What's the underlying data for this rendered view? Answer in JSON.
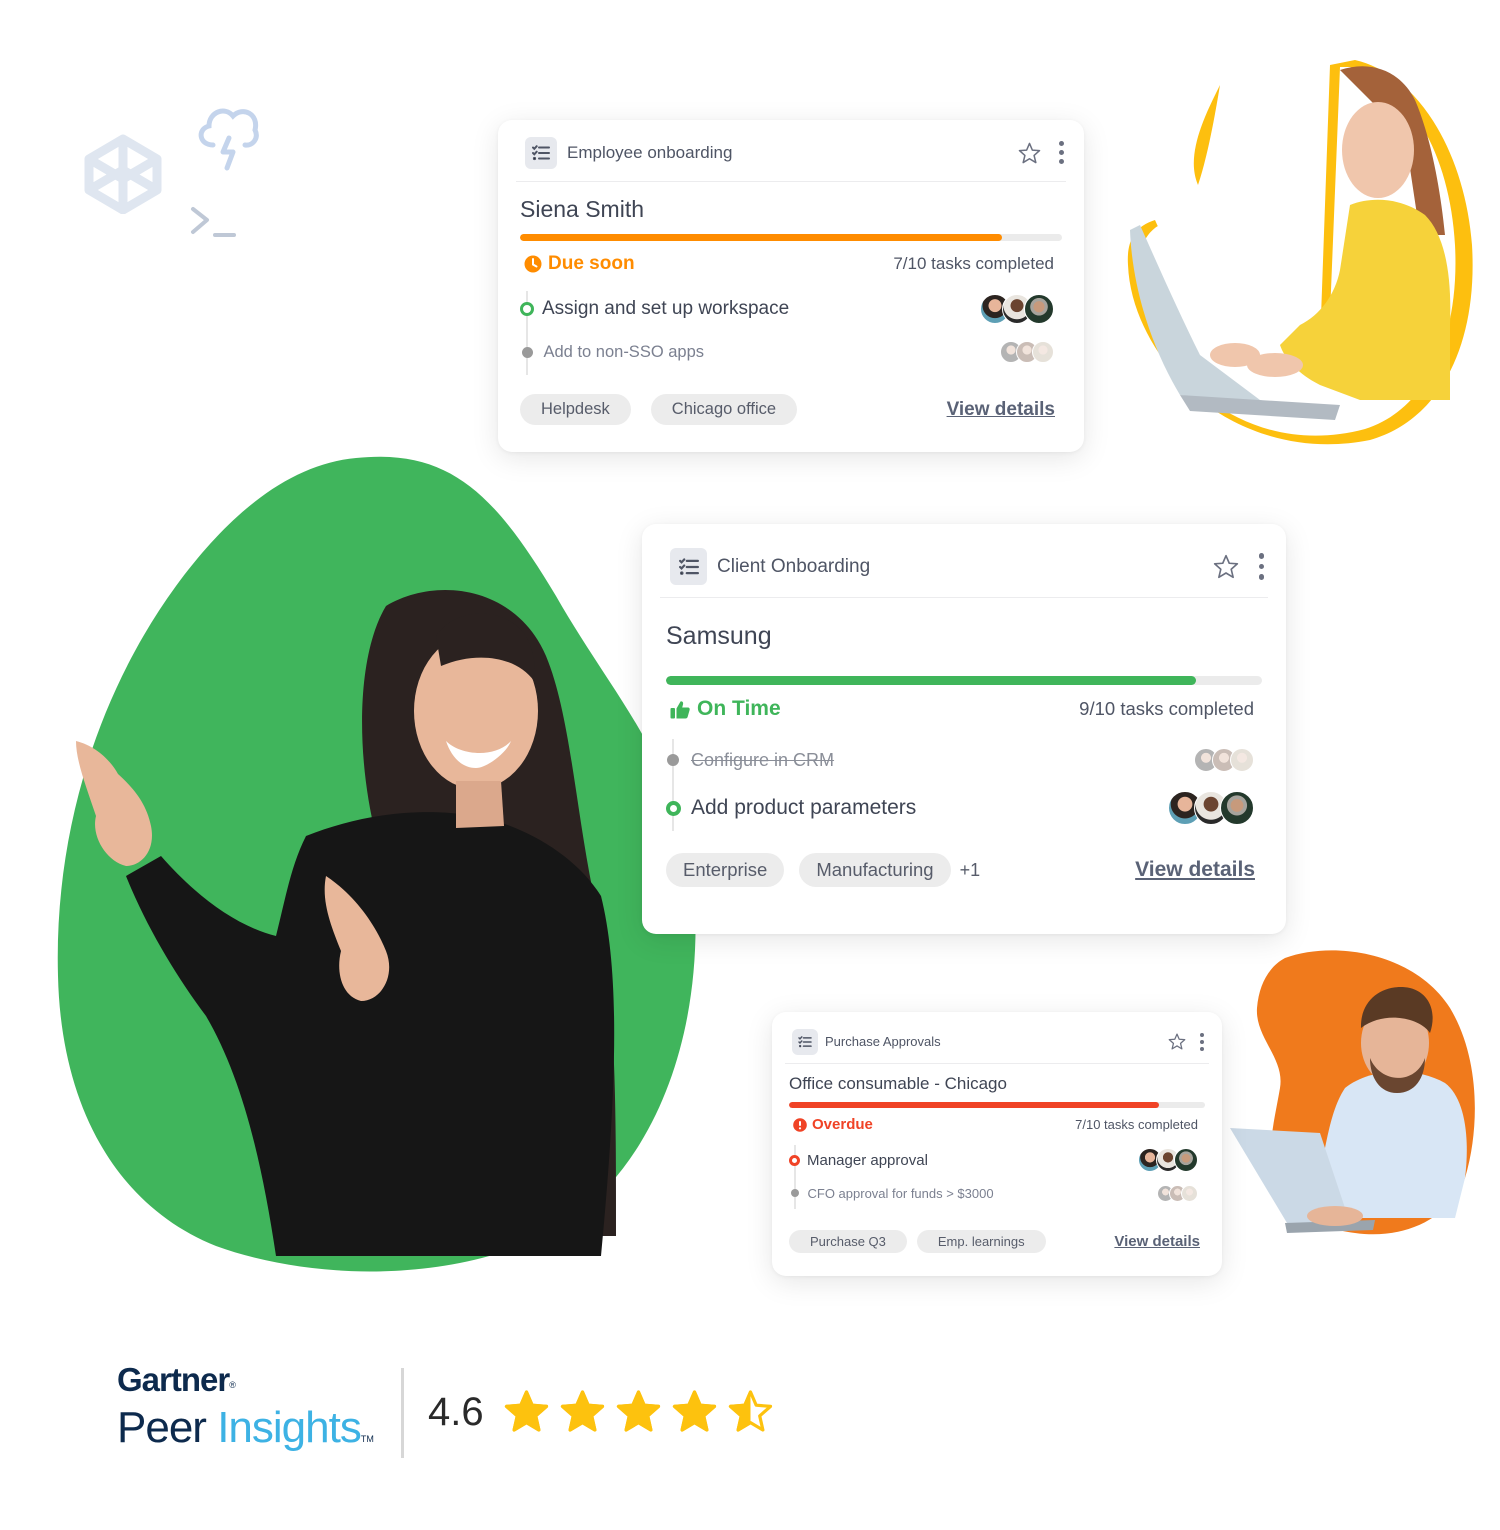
{
  "decorations": {
    "icons": [
      "codepen-cube-icon",
      "cloud-lightning-icon",
      "terminal-prompt-icon"
    ]
  },
  "colors": {
    "orange_status": "#ff8c00",
    "green_status": "#3fb55a",
    "red_status": "#f04326",
    "green_blob": "#40b55c",
    "yellow_blob": "#fdbf0f",
    "orange_blob": "#f07a1c",
    "star": "#fdc20e",
    "gartner_navy": "#0d2a4d",
    "gartner_blue": "#3db2e4"
  },
  "cards": [
    {
      "category": "Employee onboarding",
      "title": "Siena Smith",
      "progress": 0.89,
      "progress_color": "#ff8c00",
      "status": {
        "label": "Due soon",
        "icon": "clock-icon",
        "color": "#ff8c00"
      },
      "count": "7/10 tasks completed",
      "tasks": [
        {
          "label": "Assign and set up workspace",
          "state": "active",
          "avatars": 3
        },
        {
          "label": "Add to non-SSO apps",
          "state": "pending",
          "avatars": 3
        }
      ],
      "tags": [
        "Helpdesk",
        "Chicago office"
      ],
      "link": "View details"
    },
    {
      "category": "Client Onboarding",
      "title": "Samsung",
      "progress": 0.89,
      "progress_color": "#3fb55a",
      "status": {
        "label": "On Time",
        "icon": "thumbs-up-icon",
        "color": "#3fb55a"
      },
      "count": "9/10 tasks completed",
      "tasks": [
        {
          "label": "Configure in CRM",
          "state": "done",
          "avatars": 3
        },
        {
          "label": "Add product parameters",
          "state": "active",
          "avatars": 3
        }
      ],
      "tags": [
        "Enterprise",
        "Manufacturing"
      ],
      "extra_tags": "+1",
      "link": "View details"
    },
    {
      "category": "Purchase Approvals",
      "title": "Office consumable - Chicago",
      "progress": 0.89,
      "progress_color": "#f04326",
      "status": {
        "label": "Overdue",
        "icon": "alert-circle-icon",
        "color": "#f04326"
      },
      "count": "7/10 tasks completed",
      "tasks": [
        {
          "label": "Manager approval",
          "state": "active",
          "avatars": 3
        },
        {
          "label": "CFO approval for funds > $3000",
          "state": "pending",
          "avatars": 3
        }
      ],
      "tags": [
        "Purchase Q3",
        "Emp. learnings"
      ],
      "link": "View details"
    }
  ],
  "rating": {
    "brand": "Gartner",
    "brand_mark": "®",
    "product_first": "Peer",
    "product_second": "Insights",
    "trademark": "TM",
    "score": "4.6",
    "stars_value": 4.6,
    "stars_max": 5
  }
}
